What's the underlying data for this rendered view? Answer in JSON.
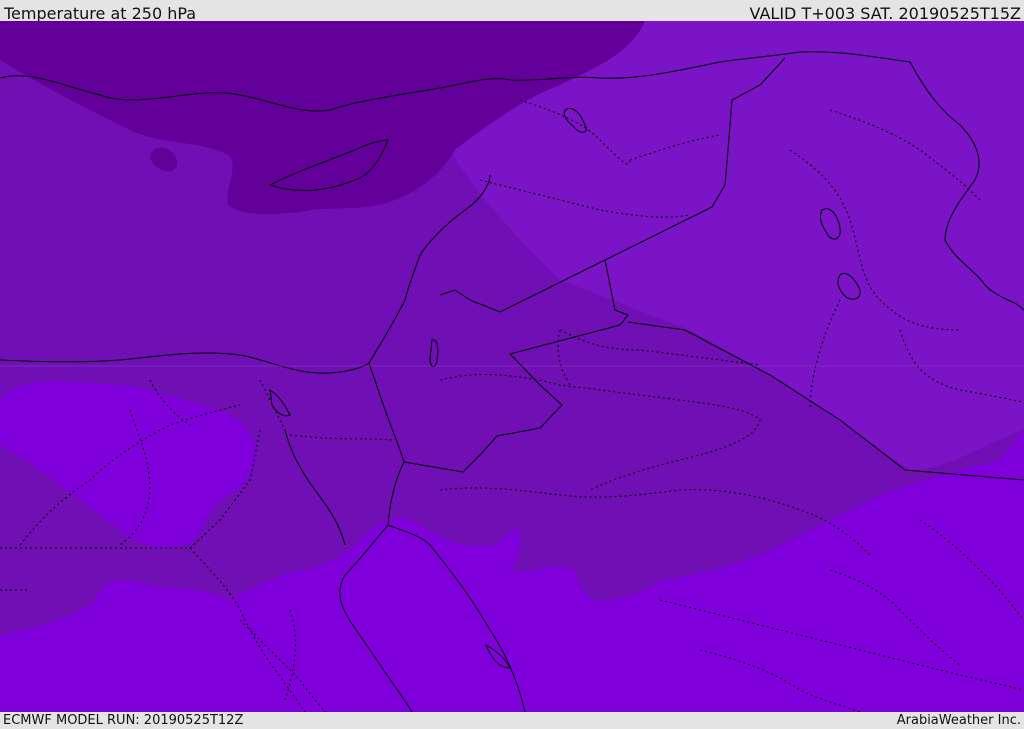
{
  "header": {
    "title": "Temperature at 250 hPa",
    "valid": "VALID T+003 SAT. 20190525T15Z"
  },
  "footer": {
    "model_run": "ECMWF MODEL RUN: 20190525T12Z",
    "credit": "ArabiaWeather Inc."
  },
  "colors": {
    "coldest_band": "#64009a",
    "mid_band": "#7010b4",
    "warmer_band": "#7a14c6",
    "warmest_band": "#7f00db",
    "border_line": "#000000"
  }
}
